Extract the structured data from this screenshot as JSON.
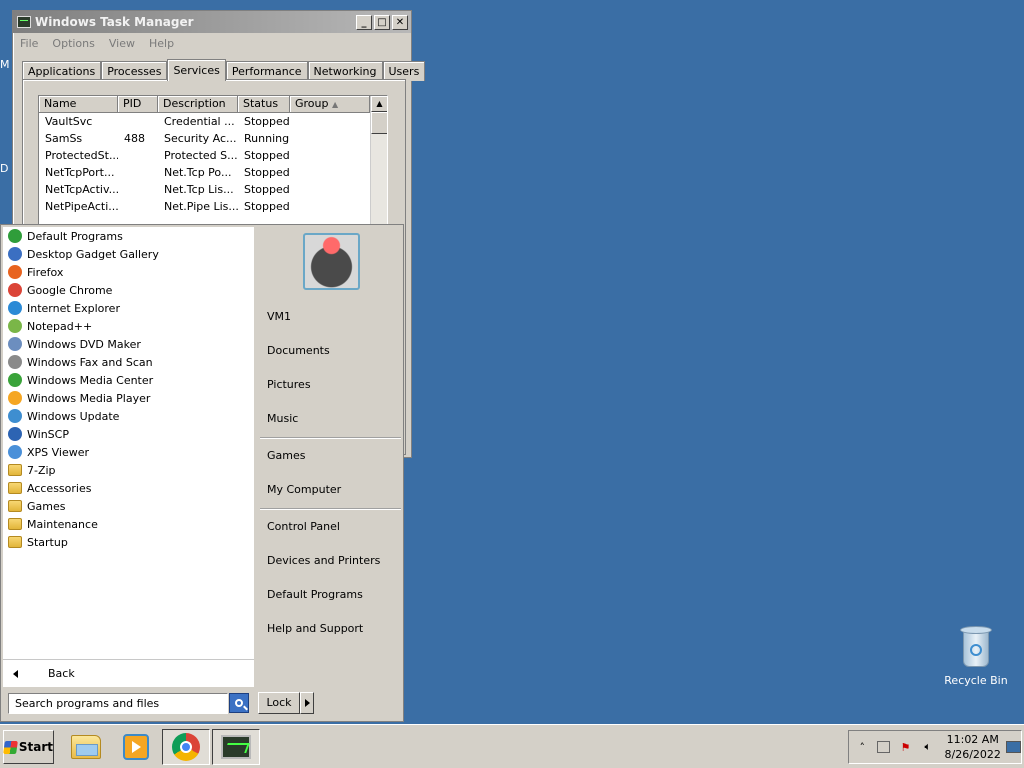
{
  "desktop": {
    "edge_letters": [
      "M",
      "D"
    ],
    "recycle_bin_label": "Recycle Bin"
  },
  "task_manager": {
    "title": "Windows Task Manager",
    "menu": [
      "File",
      "Options",
      "View",
      "Help"
    ],
    "tabs": [
      "Applications",
      "Processes",
      "Services",
      "Performance",
      "Networking",
      "Users"
    ],
    "active_tab": "Services",
    "columns": [
      "Name",
      "PID",
      "Description",
      "Status",
      "Group"
    ],
    "rows": [
      {
        "name": "VaultSvc",
        "pid": "",
        "description": "Credential ...",
        "status": "Stopped",
        "group": ""
      },
      {
        "name": "SamSs",
        "pid": "488",
        "description": "Security Ac...",
        "status": "Running",
        "group": ""
      },
      {
        "name": "ProtectedSt...",
        "pid": "",
        "description": "Protected S...",
        "status": "Stopped",
        "group": ""
      },
      {
        "name": "NetTcpPort...",
        "pid": "",
        "description": "Net.Tcp Po...",
        "status": "Stopped",
        "group": ""
      },
      {
        "name": "NetTcpActiv...",
        "pid": "",
        "description": "Net.Tcp Lis...",
        "status": "Stopped",
        "group": ""
      },
      {
        "name": "NetPipeActi...",
        "pid": "",
        "description": "Net.Pipe Lis...",
        "status": "Stopped",
        "group": ""
      }
    ]
  },
  "start_menu": {
    "programs": [
      {
        "label": "Default Programs",
        "icon": "default-programs-icon",
        "color": "#2f9d3a"
      },
      {
        "label": "Desktop Gadget Gallery",
        "icon": "gadget-icon",
        "color": "#3b6fc2"
      },
      {
        "label": "Firefox",
        "icon": "firefox-icon",
        "color": "#e8631f"
      },
      {
        "label": "Google Chrome",
        "icon": "chrome-icon",
        "color": "#db4437"
      },
      {
        "label": "Internet Explorer",
        "icon": "internet-explorer-icon",
        "color": "#2b8ad6"
      },
      {
        "label": "Notepad++",
        "icon": "notepadpp-icon",
        "color": "#7ab648"
      },
      {
        "label": "Windows DVD Maker",
        "icon": "dvd-maker-icon",
        "color": "#6c8ebf"
      },
      {
        "label": "Windows Fax and Scan",
        "icon": "fax-icon",
        "color": "#8a8a8a"
      },
      {
        "label": "Windows Media Center",
        "icon": "media-center-icon",
        "color": "#3aa33a"
      },
      {
        "label": "Windows Media Player",
        "icon": "media-player-icon",
        "color": "#f5a623"
      },
      {
        "label": "Windows Update",
        "icon": "windows-update-icon",
        "color": "#3e8ed0"
      },
      {
        "label": "WinSCP",
        "icon": "winscp-icon",
        "color": "#2d64b3"
      },
      {
        "label": "XPS Viewer",
        "icon": "xps-viewer-icon",
        "color": "#4a90d9"
      },
      {
        "label": "7-Zip",
        "icon": "folder-icon",
        "color": "#e2b53a"
      },
      {
        "label": "Accessories",
        "icon": "folder-icon",
        "color": "#e2b53a"
      },
      {
        "label": "Games",
        "icon": "folder-icon",
        "color": "#e2b53a"
      },
      {
        "label": "Maintenance",
        "icon": "folder-icon",
        "color": "#e2b53a"
      },
      {
        "label": "Startup",
        "icon": "folder-icon",
        "color": "#e2b53a"
      }
    ],
    "back_label": "Back",
    "search_placeholder": "Search programs and files",
    "user_name": "VM1",
    "right_items": [
      {
        "label": "Documents"
      },
      {
        "label": "Pictures"
      },
      {
        "label": "Music"
      },
      {
        "label": "Games"
      },
      {
        "label": "My Computer"
      },
      {
        "label": "Control Panel"
      },
      {
        "label": "Devices and Printers"
      },
      {
        "label": "Default Programs"
      },
      {
        "label": "Help and Support"
      }
    ],
    "lock_label": "Lock"
  },
  "taskbar": {
    "start_label": "Start",
    "apps": [
      "explorer-icon",
      "media-player-icon",
      "chrome-icon",
      "task-manager-icon"
    ],
    "clock_time": "11:02 AM",
    "clock_date": "8/26/2022"
  }
}
